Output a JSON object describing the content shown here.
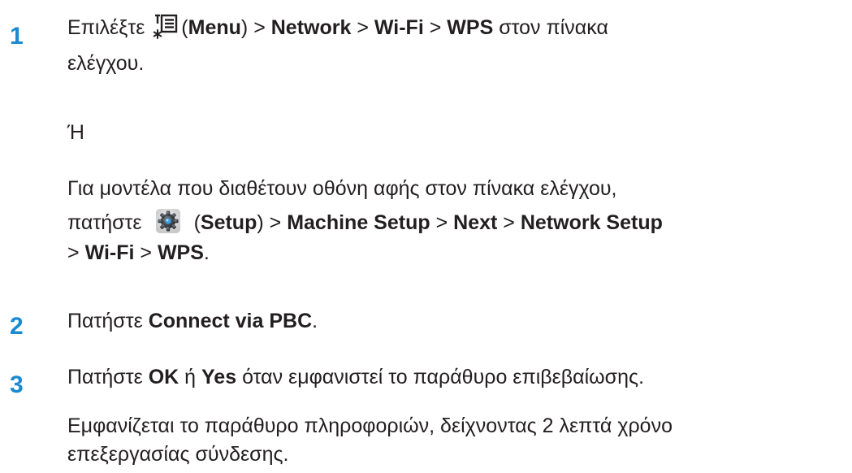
{
  "step1": {
    "number": "1",
    "line1_prefix": "Επιλέξτε",
    "menu_icon": "menu-star-icon",
    "menu_paren_open": "(",
    "menu_label": "Menu",
    "menu_paren_close": ")",
    "sep1": ">",
    "network": "Network",
    "sep2": ">",
    "wifi": "Wi-Fi",
    "sep3": ">",
    "wps": "WPS",
    "line1_suffix": "στον πίνακα",
    "line2": "ελέγχου.",
    "or": "Ή",
    "touch_line1": "Για μοντέλα που διαθέτουν οθόνη αφής στον πίνακα ελέγχου,",
    "touch_prefix": "πατήστε",
    "setup_icon": "gear-icon",
    "setup_paren_open": "(",
    "setup_label": "Setup",
    "setup_paren_close": ")",
    "sep4": ">",
    "machine_setup": "Machine Setup",
    "sep5": ">",
    "next": "Next",
    "sep6": ">",
    "network_setup": "Network Setup",
    "sep7": ">",
    "wifi2": "Wi-Fi",
    "sep8": ">",
    "wps2": "WPS",
    "end_period": "."
  },
  "step2": {
    "number": "2",
    "prefix": "Πατήστε",
    "connect_pbc": "Connect via PBC",
    "end_period": "."
  },
  "step3": {
    "number": "3",
    "prefix": "Πατήστε",
    "ok": "OK",
    "or": "ή",
    "yes": "Yes",
    "suffix": "όταν εμφανιστεί το παράθυρο επιβεβαίωσης.",
    "info_line1": "Εμφανίζεται το παράθυρο πληροφοριών, δείχνοντας 2 λεπτά χρόνο",
    "info_line2": "επεξεργασίας σύνδεσης."
  },
  "colors": {
    "step_number": "#1b8ad1",
    "text": "#231f20"
  }
}
